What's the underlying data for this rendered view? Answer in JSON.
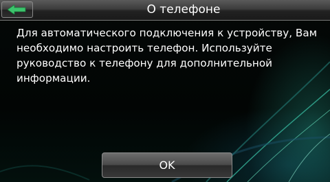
{
  "header": {
    "title": "О телефоне",
    "back_icon": "back-arrow-icon"
  },
  "dialog": {
    "message": "Для автоматического подключения к устройству, Вам необходимо настроить телефон. Используйте руководство к телефону для дополнительной информации.",
    "ok_label": "OK"
  },
  "colors": {
    "background": "#000000",
    "text": "#ffffff",
    "back_arrow": "#3cc46c",
    "accent_swirl": "#2fb89c"
  }
}
